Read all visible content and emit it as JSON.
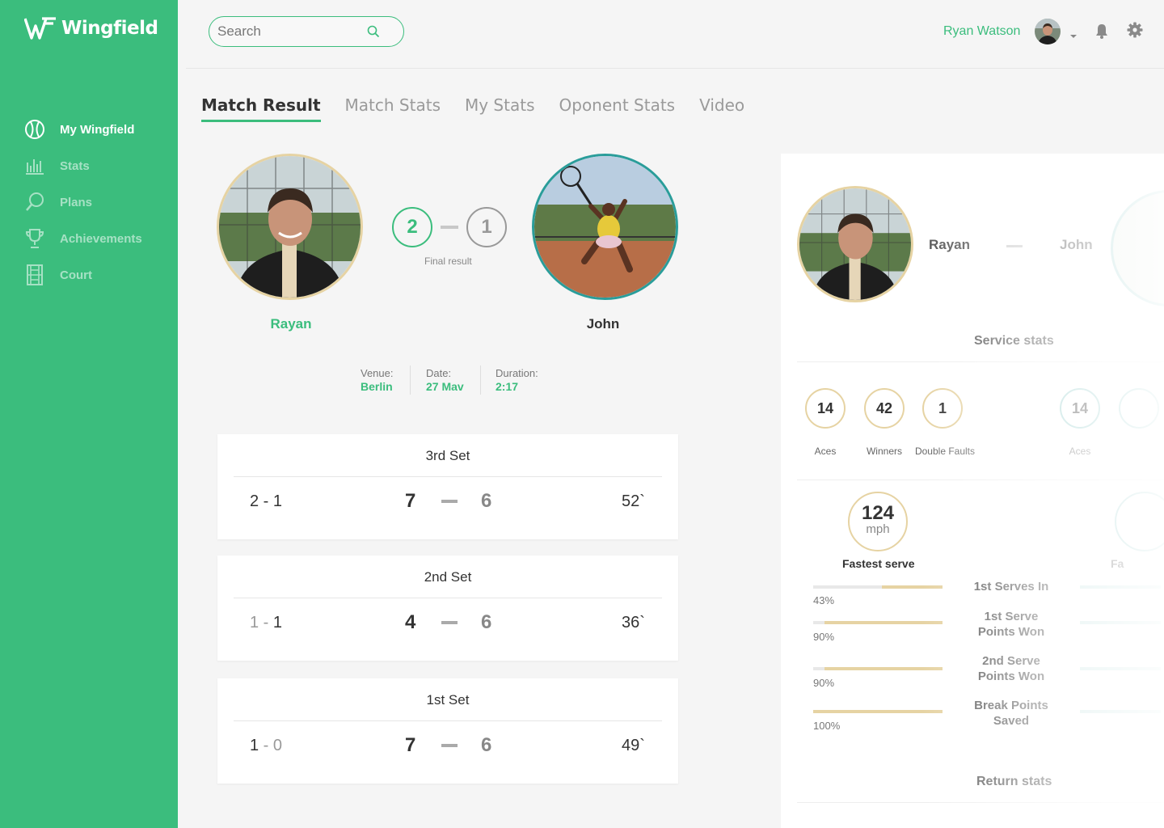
{
  "brand": {
    "name": "Wingfield"
  },
  "sidebar": {
    "items": [
      {
        "label": "My Wingfield",
        "icon": "ball-icon",
        "active": true
      },
      {
        "label": "Stats",
        "icon": "bar-chart-icon",
        "active": false
      },
      {
        "label": "Plans",
        "icon": "search-plan-icon",
        "active": false
      },
      {
        "label": "Achievements",
        "icon": "trophy-icon",
        "active": false
      },
      {
        "label": "Court",
        "icon": "court-icon",
        "active": false
      }
    ]
  },
  "header": {
    "search_placeholder": "Search",
    "user_name": "Ryan Watson"
  },
  "tabs": [
    {
      "label": "Match Result",
      "active": true
    },
    {
      "label": "Match Stats",
      "active": false
    },
    {
      "label": "My Stats",
      "active": false
    },
    {
      "label": "Oponent Stats",
      "active": false
    },
    {
      "label": "Video",
      "active": false
    }
  ],
  "match": {
    "player1": "Rayan",
    "player2": "John",
    "score1": "2",
    "score2": "1",
    "final_label": "Final result",
    "venue_label": "Venue:",
    "venue": "Berlin",
    "date_label": "Date:",
    "date": "27 Mav",
    "duration_label": "Duration:",
    "duration": "2:17"
  },
  "sets": [
    {
      "title": "3rd Set",
      "sets_a": "2",
      "sets_b": "1",
      "games_a": "7",
      "games_b": "6",
      "time": "52`"
    },
    {
      "title": "2nd Set",
      "sets_a": "1",
      "sets_b": "1",
      "games_a": "4",
      "games_b": "6",
      "time": "36`"
    },
    {
      "title": "1st Set",
      "sets_a": "1",
      "sets_b": "0",
      "games_a": "7",
      "games_b": "6",
      "time": "49`"
    }
  ],
  "panel": {
    "player1": "Rayan",
    "player2": "John",
    "service_title": "Service stats",
    "stats": [
      {
        "value": "14",
        "label": "Aces"
      },
      {
        "value": "42",
        "label": "Winners"
      },
      {
        "value": "1",
        "label": "Double Faults"
      }
    ],
    "stats_mirror": [
      {
        "value": "14",
        "label": "Aces"
      }
    ],
    "fastest_value": "124",
    "fastest_unit": "mph",
    "fastest_label": "Fastest serve",
    "fastest_mirror_label": "Fa",
    "bars": [
      {
        "pct_label": "43%",
        "fill": 0.47,
        "label": "1st Serves In"
      },
      {
        "pct_label": "90%",
        "fill": 0.91,
        "label": "1st Serve Points Won"
      },
      {
        "pct_label": "90%",
        "fill": 0.91,
        "label": "2nd Serve Points Won"
      },
      {
        "pct_label": "100%",
        "fill": 1.0,
        "label": "Break Points Saved"
      }
    ],
    "return_title": "Return stats"
  },
  "colors": {
    "accent": "#3bbd7d",
    "gold": "#e6d3a3",
    "teal": "#2a9d9a"
  }
}
